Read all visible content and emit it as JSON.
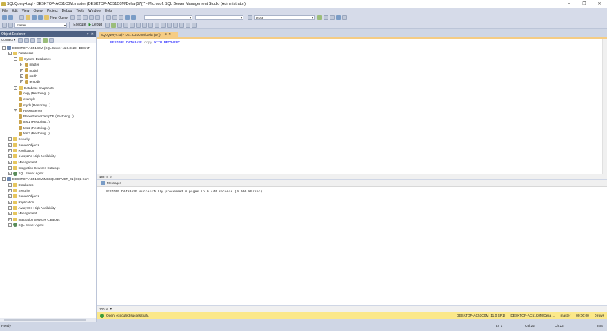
{
  "window": {
    "title": "SQLQuery4.sql - DESKTOP-AC51C0M.master (DESKTOP-AC51C0M\\Delia (57))* - Microsoft SQL Server Management Studio (Administrator)",
    "minimize": "–",
    "maximize": "❐",
    "close": "✕"
  },
  "menu": [
    "File",
    "Edit",
    "View",
    "Query",
    "Project",
    "Debug",
    "Tools",
    "Window",
    "Help"
  ],
  "toolbar": {
    "new_query": "New Query",
    "search_value": "prose",
    "database": "master",
    "execute": "Execute",
    "debug": "Debug"
  },
  "object_explorer": {
    "title": "Object Explorer",
    "header_buttons": "▾ ✕",
    "connect": "Connect ▾",
    "tree": [
      {
        "label": "DESKTOP-AC51C0M (SQL Server 11.0.3128 - DESKT",
        "level": 0,
        "kind": "srv",
        "exp": "−"
      },
      {
        "label": "Databases",
        "level": 1,
        "kind": "fold",
        "exp": "−"
      },
      {
        "label": "System Databases",
        "level": 2,
        "kind": "fold",
        "exp": "−"
      },
      {
        "label": "master",
        "level": 3,
        "kind": "db",
        "exp": "+"
      },
      {
        "label": "model",
        "level": 3,
        "kind": "db",
        "exp": "+"
      },
      {
        "label": "msdb",
        "level": 3,
        "kind": "db",
        "exp": "+"
      },
      {
        "label": "tempdb",
        "level": 3,
        "kind": "db",
        "exp": "+"
      },
      {
        "label": "Database Snapshots",
        "level": 2,
        "kind": "fold",
        "exp": "+"
      },
      {
        "label": "copy (Restoring...)",
        "level": 2,
        "kind": "db",
        "exp": ""
      },
      {
        "label": "example",
        "level": 2,
        "kind": "db",
        "exp": ""
      },
      {
        "label": "mydb (Restoring...)",
        "level": 2,
        "kind": "db",
        "exp": ""
      },
      {
        "label": "ReportServer",
        "level": 2,
        "kind": "db",
        "exp": "+"
      },
      {
        "label": "ReportServerTempDB (Restoring...)",
        "level": 2,
        "kind": "db",
        "exp": ""
      },
      {
        "label": "test1 (Restoring...)",
        "level": 2,
        "kind": "db",
        "exp": ""
      },
      {
        "label": "test2 (Restoring...)",
        "level": 2,
        "kind": "db",
        "exp": ""
      },
      {
        "label": "test3 (Restoring...)",
        "level": 2,
        "kind": "db",
        "exp": ""
      },
      {
        "label": "Security",
        "level": 1,
        "kind": "fold",
        "exp": "+"
      },
      {
        "label": "Server Objects",
        "level": 1,
        "kind": "fold",
        "exp": "+"
      },
      {
        "label": "Replication",
        "level": 1,
        "kind": "fold",
        "exp": "+"
      },
      {
        "label": "AlwaysOn High Availability",
        "level": 1,
        "kind": "fold",
        "exp": "+"
      },
      {
        "label": "Management",
        "level": 1,
        "kind": "fold",
        "exp": "+"
      },
      {
        "label": "Integration Services Catalogs",
        "level": 1,
        "kind": "fold",
        "exp": "+"
      },
      {
        "label": "SQL Server Agent",
        "level": 1,
        "kind": "agent",
        "exp": "+"
      },
      {
        "label": "DESKTOP-AC51C0M\\MSSQLSERVER_01 (SQL Serv",
        "level": 0,
        "kind": "srv",
        "exp": "−"
      },
      {
        "label": "Databases",
        "level": 1,
        "kind": "fold",
        "exp": "+"
      },
      {
        "label": "Security",
        "level": 1,
        "kind": "fold",
        "exp": "+"
      },
      {
        "label": "Server Objects",
        "level": 1,
        "kind": "fold",
        "exp": "+"
      },
      {
        "label": "Replication",
        "level": 1,
        "kind": "fold",
        "exp": "+"
      },
      {
        "label": "AlwaysOn High Availability",
        "level": 1,
        "kind": "fold",
        "exp": "+"
      },
      {
        "label": "Management",
        "level": 1,
        "kind": "fold",
        "exp": "+"
      },
      {
        "label": "Integration Services Catalogs",
        "level": 1,
        "kind": "fold",
        "exp": "+"
      },
      {
        "label": "SQL Server Agent",
        "level": 1,
        "kind": "agent",
        "exp": "+"
      }
    ]
  },
  "editor": {
    "tab_label": "SQLQuery4.sql - DE...C51C0M\\Delia (57))*",
    "tab_pin": "⊕",
    "tab_close": "✕",
    "code": {
      "kw1": "RESTORE DATABASE",
      "ident": "copy",
      "kw2": "WITH RECOVERY"
    },
    "zoom": "100 %"
  },
  "results": {
    "tab_label": "Messages",
    "message": "RESTORE DATABASE successfully processed 0 pages in 0.444 seconds (0.000 MB/sec).",
    "zoom": "100 %"
  },
  "query_status": {
    "text": "Query executed successfully.",
    "server": "DESKTOP-AC51C0M (11.0 SP1)",
    "user": "DESKTOP-AC51C0M\\Delia ...",
    "database": "master",
    "time": "00:00:00",
    "rows": "0 rows"
  },
  "status_bar": {
    "ready": "Ready",
    "ln": "Ln 1",
    "col": "Col 22",
    "ch": "Ch 22",
    "ins": "INS"
  }
}
